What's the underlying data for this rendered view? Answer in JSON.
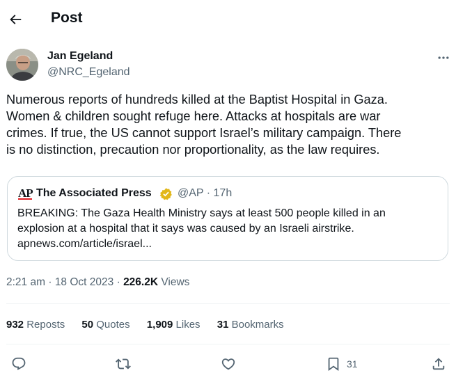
{
  "header": {
    "title": "Post"
  },
  "author": {
    "name": "Jan Egeland",
    "handle": "@NRC_Egeland"
  },
  "tweet": {
    "text": "Numerous reports of hundreds killed at the Baptist Hospital in Gaza.\nWomen & children sought refuge here. Attacks at hospitals are war\ncrimes. If true, the US cannot support Israel’s military campaign.  There\nis no distinction, precaution nor proportionality, as the law requires."
  },
  "quote": {
    "logo_text": "AP",
    "name": "The Associated Press",
    "handle": "@AP",
    "separator": "·",
    "time": "17h",
    "text": "BREAKING: The Gaza Health Ministry says at least 500 people killed in an\nexplosion at a hospital that it says was caused by an Israeli airstrike.\napnews.com/article/israel..."
  },
  "meta": {
    "time": "2:21 am",
    "separator": "·",
    "date": "18 Oct 2023",
    "separator2": "·",
    "views_count": "226.2K",
    "views_label": "Views"
  },
  "stats": {
    "reposts_count": "932",
    "reposts_label": "Reposts",
    "quotes_count": "50",
    "quotes_label": "Quotes",
    "likes_count": "1,909",
    "likes_label": "Likes",
    "bookmarks_count": "31",
    "bookmarks_label": "Bookmarks"
  },
  "actions": {
    "bookmark_count": "31"
  },
  "colors": {
    "verified_gold": "#e2b719",
    "text_secondary": "#536471",
    "text_primary": "#0f1419",
    "border": "#cfd9de",
    "ap_red": "#e01e24"
  },
  "icons": [
    "back-arrow-icon",
    "more-icon",
    "verified-badge-icon",
    "reply-icon",
    "repost-icon",
    "like-icon",
    "bookmark-icon",
    "share-icon"
  ]
}
